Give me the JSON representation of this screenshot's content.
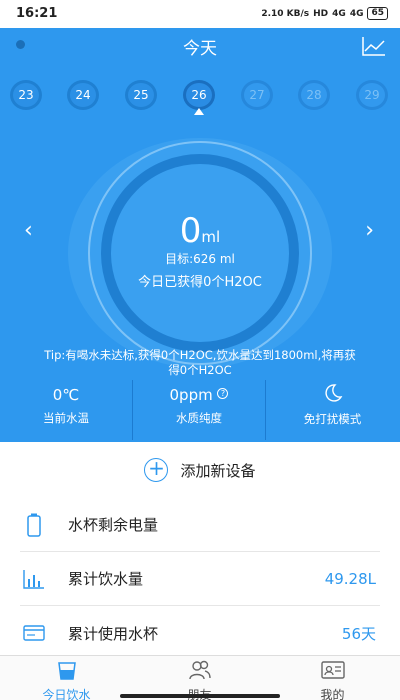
{
  "status_bar": {
    "time": "16:21",
    "speed": "2.10 KB/s",
    "hd": "HD",
    "network1": "4G",
    "network2": "4G",
    "battery": "65"
  },
  "header": {
    "title": "今天",
    "trend_icon": "line-chart-icon"
  },
  "dates": [
    {
      "label": "23",
      "state": "normal"
    },
    {
      "label": "24",
      "state": "normal"
    },
    {
      "label": "25",
      "state": "normal"
    },
    {
      "label": "26",
      "state": "active"
    },
    {
      "label": "27",
      "state": "dim"
    },
    {
      "label": "28",
      "state": "dim"
    },
    {
      "label": "29",
      "state": "dim"
    }
  ],
  "gauge": {
    "amount": "0",
    "unit": "ml",
    "goal": "目标:626 ml",
    "earned": "今日已获得0个H2OC"
  },
  "tip": "Tip:有喝水未达标,获得0个H2OC,饮水量达到1800ml,将再获得0个H2OC",
  "stats": [
    {
      "value": "0℃",
      "label": "当前水温"
    },
    {
      "value": "0ppm",
      "label": "水质纯度",
      "icon": "question-icon"
    },
    {
      "value": "",
      "label": "免打扰模式",
      "icon": "moon-icon"
    }
  ],
  "add_device": {
    "label": "添加新设备",
    "icon": "plus-circle-icon"
  },
  "rows": [
    {
      "label": "水杯剩余电量",
      "value": "",
      "icon": "battery-icon"
    },
    {
      "label": "累计饮水量",
      "value": "49.28L",
      "icon": "bar-chart-icon"
    },
    {
      "label": "累计使用水杯",
      "value": "56天",
      "icon": "card-icon"
    }
  ],
  "tabs": [
    {
      "label": "今日饮水",
      "icon": "water-cup-icon",
      "active": true
    },
    {
      "label": "朋友",
      "icon": "friends-icon",
      "active": false
    },
    {
      "label": "我的",
      "icon": "profile-card-icon",
      "active": false
    }
  ],
  "colors": {
    "primary": "#2e98ee",
    "ring_dark": "#1f7fd1",
    "text": "#222222"
  }
}
